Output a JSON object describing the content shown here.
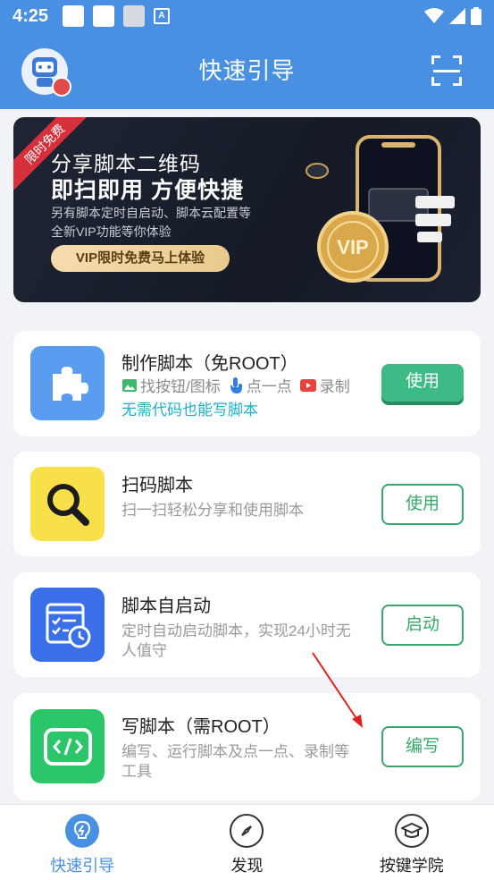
{
  "status_bar": {
    "time": "4:25",
    "icons": [
      "notification-icon",
      "notification-icon",
      "notification-icon",
      "app-a-icon",
      "wifi-icon",
      "signal-icon",
      "battery-icon"
    ]
  },
  "app_bar": {
    "title": "快速引导",
    "left_icon": "avatar",
    "right_icon": "scan-icon"
  },
  "banner": {
    "ribbon": "限时免费",
    "title_line1": "分享脚本二维码",
    "title_line2": "即扫即用 方便快捷",
    "desc_line1": "另有脚本定时自启动、脚本云配置等",
    "desc_line2": "全新VIP功能等你体验",
    "cta": "VIP限时免费马上体验",
    "coin_text": "VIP"
  },
  "cards": [
    {
      "icon": "puzzle-icon",
      "title": "制作脚本（免ROOT）",
      "features": [
        {
          "icon": "image-icon",
          "label": "找按钮/图标"
        },
        {
          "icon": "tap-icon",
          "label": "点一点"
        },
        {
          "icon": "record-icon",
          "label": "录制"
        }
      ],
      "tagline": "无需代码也能写脚本",
      "button": "使用"
    },
    {
      "icon": "magnifier-icon",
      "title": "扫码脚本",
      "subtitle": "扫一扫轻松分享和使用脚本",
      "button": "使用"
    },
    {
      "icon": "schedule-icon",
      "title": "脚本自启动",
      "subtitle": "定时自动启动脚本，实现24小时无人值守",
      "button": "启动"
    },
    {
      "icon": "code-icon",
      "title": "写脚本（需ROOT）",
      "subtitle": "编写、运行脚本及点一点、录制等工具",
      "button": "编写"
    }
  ],
  "bottom_nav": {
    "tabs": [
      {
        "icon": "lightbulb-icon",
        "label": "快速引导",
        "active": true
      },
      {
        "icon": "compass-icon",
        "label": "发现",
        "active": false
      },
      {
        "icon": "graduation-cap-icon",
        "label": "按键学院",
        "active": false
      }
    ]
  },
  "colors": {
    "primary": "#4a90e2",
    "green": "#3aa66b",
    "green_solid": "#3dbb86",
    "tagline": "#1fb0c9",
    "subtitle": "#9a9a9a",
    "banner_bg": "#1a1f2c",
    "gold": "#e9c98d",
    "ribbon": "#d8303a",
    "icon_blue": "#5a9cf0",
    "icon_yellow": "#f7e04a",
    "icon_royal": "#3a6fe8",
    "icon_green": "#2cc66a"
  }
}
